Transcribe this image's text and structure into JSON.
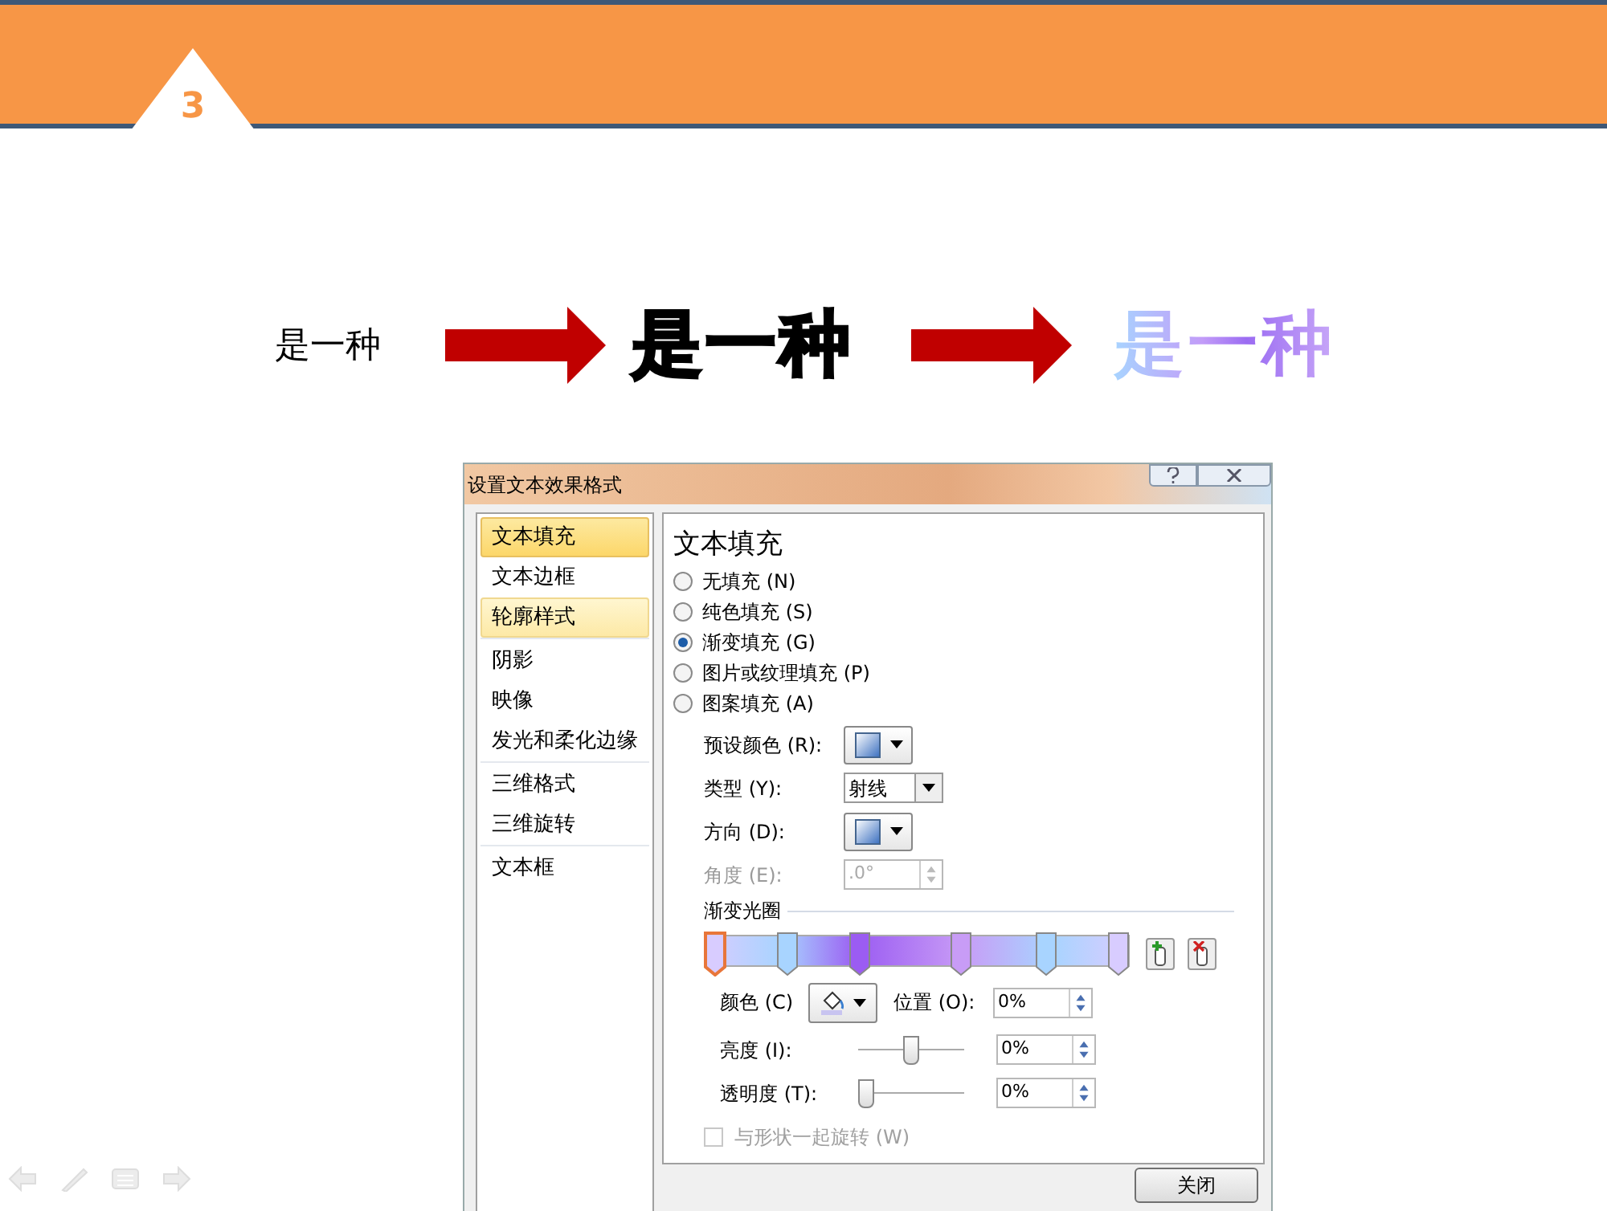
{
  "slide": {
    "number": "3",
    "steps": [
      {
        "kind": "plain",
        "text": "是一种"
      },
      {
        "kind": "bold",
        "text": "是一种"
      },
      {
        "kind": "gradient",
        "text": "是一种"
      }
    ]
  },
  "dialog": {
    "title": "设置文本效果格式",
    "sidebar": [
      [
        {
          "label": "文本填充",
          "selected": true,
          "hover": false
        },
        {
          "label": "文本边框",
          "selected": false,
          "hover": false
        },
        {
          "label": "轮廓样式",
          "selected": false,
          "hover": true
        }
      ],
      [
        {
          "label": "阴影",
          "selected": false,
          "hover": false
        },
        {
          "label": "映像",
          "selected": false,
          "hover": false
        },
        {
          "label": "发光和柔化边缘",
          "selected": false,
          "hover": false
        }
      ],
      [
        {
          "label": "三维格式",
          "selected": false,
          "hover": false
        },
        {
          "label": "三维旋转",
          "selected": false,
          "hover": false
        }
      ],
      [
        {
          "label": "文本框",
          "selected": false,
          "hover": false
        }
      ]
    ],
    "panel_title": "文本填充",
    "fill_options": [
      {
        "label": "无填充 (N)",
        "selected": false
      },
      {
        "label": "纯色填充 (S)",
        "selected": false
      },
      {
        "label": "渐变填充 (G)",
        "selected": true
      },
      {
        "label": "图片或纹理填充 (P)",
        "selected": false
      },
      {
        "label": "图案填充 (A)",
        "selected": false
      }
    ],
    "fields": [
      {
        "kind": "swatch",
        "label": "预设颜色 (R):"
      },
      {
        "kind": "select",
        "label": "类型 (Y):",
        "value": "射线"
      },
      {
        "kind": "swatch",
        "label": "方向 (D):"
      },
      {
        "kind": "spinner",
        "label": "角度 (E):",
        "value": ".0°",
        "disabled": true
      }
    ],
    "stops_title": "渐变光圈",
    "stops": [
      {
        "level": 0,
        "color": "#d8ccff",
        "selected": true
      },
      {
        "level": 0.18,
        "color": "#a8d4ff",
        "selected": false
      },
      {
        "level": 0.36,
        "color": "#9b5cf2",
        "selected": false
      },
      {
        "level": 0.61,
        "color": "#c89cf6",
        "selected": false
      },
      {
        "level": 0.82,
        "color": "#a8d4ff",
        "selected": false
      },
      {
        "level": 1,
        "color": "#d8ccff",
        "selected": false
      }
    ],
    "color_label": "颜色 (C)",
    "position_label": "位置 (O):",
    "position_value": "0%",
    "sliders": [
      {
        "label": "亮度 (I):",
        "level": 0.5,
        "value": "0%"
      },
      {
        "label": "透明度 (T):",
        "level": 0,
        "value": "0%"
      }
    ],
    "rotate_checkbox": {
      "label": "与形状一起旋转 (W)",
      "checked": false,
      "disabled": true
    },
    "close_button": "关闭"
  }
}
